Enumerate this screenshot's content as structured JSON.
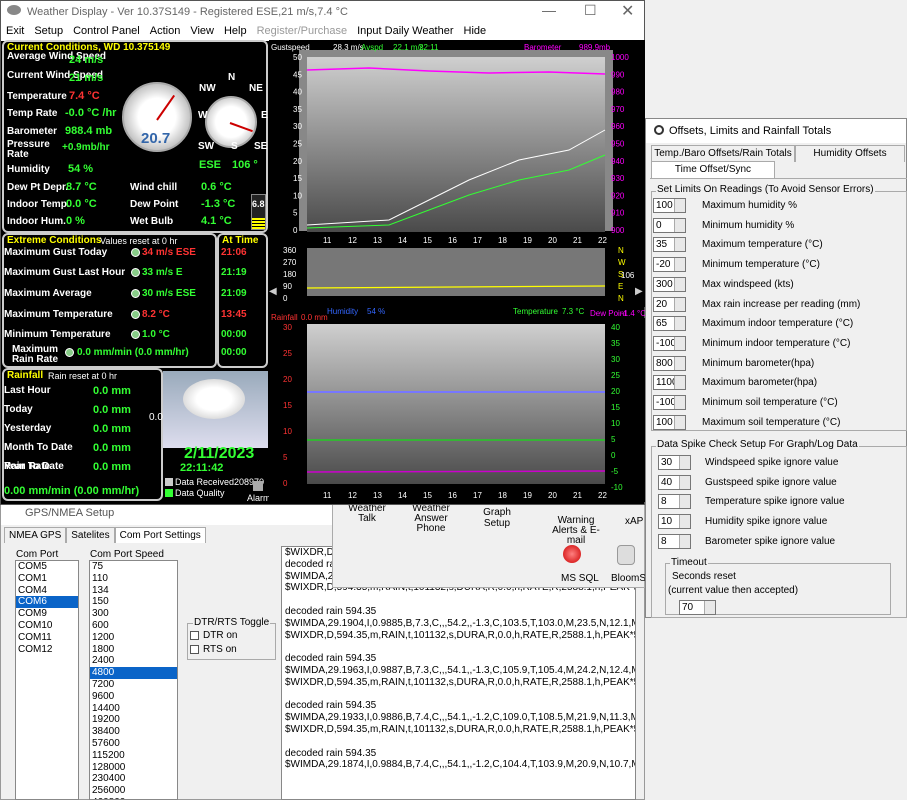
{
  "main_window": {
    "title": "Weather Display - Ver 10.37S149 - Registered ESE,21 m/s,7.4 °C",
    "menu": [
      "Exit",
      "Setup",
      "Control Panel",
      "Action",
      "View",
      "Help",
      "Register/Purchase",
      "Input Daily Weather",
      "Hide"
    ]
  },
  "current": {
    "header": "Current Conditions, WD 10.375149",
    "avg_wind_label": "Average Wind Speed",
    "avg_wind": "24 m/s",
    "cur_wind_label": "Current Wind Speed",
    "cur_wind": "21 m/s",
    "temp_label": "Temperature",
    "temp": "7.4 °C",
    "temp_rate_label": "Temp Rate",
    "temp_rate": "-0.0 °C /hr",
    "baro_label": "Barometer",
    "baro": "988.4 mb",
    "pressure_rate_label": "Pressure Rate",
    "pressure_rate": "+0.9mb/hr",
    "humidity_label": "Humidity",
    "humidity": "54 %",
    "dew_label": "Dew Pt Depr.",
    "dew": "8.7 °C",
    "indoor_temp_label": "Indoor Temp.",
    "indoor_temp": "0.0 °C",
    "indoor_hum_label": "Indoor Hum.",
    "indoor_hum": "0 %",
    "windchill_label": "Wind chill",
    "windchill": "0.6 °C",
    "dewpoint_label": "Dew Point",
    "dewpoint": "-1.3 °C",
    "wetbulb_label": "Wet Bulb",
    "wetbulb": "4.1 °C",
    "gauge_value": "20.7",
    "wind_dir": "ESE",
    "wind_deg": "106 °",
    "uv": "6.8",
    "compass": {
      "n": "N",
      "nw": "NW",
      "ne": "NE",
      "w": "W",
      "e": "E",
      "sw": "SW",
      "s": "S",
      "se": "SE"
    }
  },
  "extremes": {
    "header": "Extreme Conditions",
    "note": "Values reset at 0 hr",
    "at_time": "At Time",
    "rows": [
      {
        "label": "Maximum Gust Today",
        "value": "34 m/s ESE",
        "time": "21:06"
      },
      {
        "label": "Maximum Gust Last Hour",
        "value": "33 m/s  E",
        "time": "21:19"
      },
      {
        "label": "Maximum Average",
        "value": "30 m/s ESE",
        "time": "21:09"
      },
      {
        "label": "Maximum Temperature",
        "value": "8.2 °C",
        "time": "13:45"
      },
      {
        "label": "Minimum Temperature",
        "value": "1.0 °C",
        "time": "00:00"
      },
      {
        "label": "Maximum Rain Rate",
        "value": "0.0 mm/min (0.0 mm/hr)",
        "time": "00:00"
      }
    ]
  },
  "rain": {
    "header": "Rainfall",
    "note": "Rain reset at 0 hr",
    "rows": [
      {
        "label": "Last Hour",
        "value": "0.0 mm"
      },
      {
        "label": "Today",
        "value": "0.0 mm"
      },
      {
        "label": "Yesterday",
        "value": "0.0 mm"
      },
      {
        "label": "Month To Date",
        "value": "0.0 mm"
      },
      {
        "label": "Year To Date",
        "value": "0.0 mm"
      }
    ],
    "rate_label": "Rain Rate",
    "rate": "0.00 mm/min (0.00 mm/hr)"
  },
  "status": {
    "date": "2/11/2023",
    "time": "22:11:42",
    "icon_value": "0.0",
    "data_received": "Data Received208970",
    "data_quality": "Data Quality",
    "alarm": "Alarm"
  },
  "graph1": {
    "gust_label": "Gustspeed",
    "gust_val": "28.3 m/s",
    "avg_label": "Avspd",
    "avg_val": "22.1 m/s",
    "time_val": "22:11",
    "baro_label": "Barometer",
    "baro_val": "989.9mb",
    "yleft": [
      "50",
      "45",
      "40",
      "35",
      "30",
      "25",
      "20",
      "15",
      "10",
      "5",
      "0"
    ],
    "yright": [
      "1000",
      "990",
      "980",
      "970",
      "960",
      "950",
      "940",
      "930",
      "920",
      "910",
      "900"
    ],
    "x": [
      "11",
      "12",
      "13",
      "14",
      "15",
      "16",
      "17",
      "18",
      "19",
      "20",
      "21",
      "22"
    ]
  },
  "graph2": {
    "yleft": [
      "360",
      "270",
      "180",
      "90",
      "0"
    ],
    "dirs": [
      "N",
      "W",
      "S",
      "E",
      "N"
    ],
    "wdval": "106",
    "hum_label": "Humidity",
    "hum_val": "54 %",
    "temp_label": "Temperature",
    "temp_val": "7.3 °C",
    "dew_label": "Dew Point",
    "dew_val": "-1.4 °C"
  },
  "graph3": {
    "rain_label": "Rainfall",
    "rain_val": "0.0 mm",
    "yleft": [
      "30",
      "25",
      "20",
      "15",
      "10",
      "5",
      "0"
    ],
    "yright": [
      "40",
      "35",
      "30",
      "25",
      "20",
      "15",
      "10",
      "5",
      "0",
      "-5",
      "-10"
    ],
    "x": [
      "11",
      "12",
      "13",
      "14",
      "15",
      "16",
      "17",
      "18",
      "19",
      "20",
      "21",
      "22"
    ]
  },
  "gps": {
    "title": "GPS/NMEA Setup",
    "tabs": [
      "NMEA GPS",
      "Satelites",
      "Com Port Settings"
    ],
    "com_port_label": "Com Port",
    "com_ports": [
      "COM5",
      "COM1",
      "COM4",
      "COM6",
      "COM9",
      "COM10",
      "COM11",
      "COM12"
    ],
    "speed_label": "Com Port Speed",
    "speeds": [
      "75",
      "110",
      "134",
      "150",
      "300",
      "600",
      "1200",
      "1800",
      "2400",
      "4800",
      "7200",
      "9600",
      "14400",
      "19200",
      "38400",
      "57600",
      "115200",
      "128000",
      "230400",
      "256000",
      "460800",
      "921600"
    ],
    "dtr_group": "DTR/RTS Toggle",
    "dtr": "DTR on",
    "rts": "RTS on",
    "log": [
      "$WIXDR,D,",
      "decoded rai",
      "$WIMDA,29.1904,I,0.9885,B,7.4,C,,,54.2,,-1.2,C,111.3,T,110.8,M,22.7,N,11.7,M*46",
      "$WIXDR,D,594.35,m,RAIN,t,101132,s,DURA,R,0.0,h,RATE,R,2588.1,h,PEAK*53",
      "",
      "decoded rain 594.35",
      "$WIMDA,29.1904,I,0.9885,B,7.3,C,,,54.2,,-1.3,C,103.5,T,103.0,M,23.5,N,12.1,M*49",
      "$WIXDR,D,594.35,m,RAIN,t,101132,s,DURA,R,0.0,h,RATE,R,2588.1,h,PEAK*53",
      "",
      "decoded rain 594.35",
      "$WIMDA,29.1963,I,0.9887,B,7.3,C,,,54.1,,-1.3,C,105.9,T,105.4,M,24.2,N,12.4,M*44",
      "$WIXDR,D,594.35,m,RAIN,t,101132,s,DURA,R,0.0,h,RATE,R,2588.1,h,PEAK*53",
      "",
      "decoded rain 594.35",
      "$WIMDA,29.1933,I,0.9886,B,7.4,C,,,54.1,,-1.2,C,109.0,T,108.5,M,21.9,N,11.3,M*45",
      "$WIXDR,D,594.35,m,RAIN,t,101132,s,DURA,R,0.0,h,RATE,R,2588.1,h,PEAK*53",
      "",
      "decoded rain 594.35",
      "$WIMDA,29.1874,I,0.9884,B,7.4,C,,,54.1,,-1.2,C,104.4,T,103.9,M,20.9,N,10.7,M*45"
    ]
  },
  "control_panel": {
    "items": [
      "Weather Talk",
      "Weather Answer Phone",
      "Graph Setup",
      "Warning Alerts & E-mail",
      "xAP",
      "MS SQL",
      "BloomSk"
    ]
  },
  "offsets": {
    "title": "Offsets, Limits and Rainfall Totals",
    "tabs": [
      "Temp./Baro Offsets/Rain Totals",
      "Humidity Offsets",
      "Time Offset/Sync"
    ],
    "limits_group": "Set Limits On Readings (To Avoid Sensor Errors)",
    "limits": [
      {
        "value": "100",
        "label": "Maximum humidity %"
      },
      {
        "value": "0",
        "label": "Minimum humidity %"
      },
      {
        "value": "35",
        "label": "Maximum temperature (°C)"
      },
      {
        "value": "-20",
        "label": "Minimum temperature (°C)"
      },
      {
        "value": "300",
        "label": "Max windspeed (kts)"
      },
      {
        "value": "20",
        "label": "Max rain  increase per reading (mm)"
      },
      {
        "value": "65",
        "label": "Maximum indoor temperature (°C)"
      },
      {
        "value": "-100",
        "label": "Minimum indoor temperature (°C)"
      },
      {
        "value": "800",
        "label": "Minimum barometer(hpa)"
      },
      {
        "value": "1100",
        "label": "Maximum barometer(hpa)"
      },
      {
        "value": "-100",
        "label": "Minimum soil temperature (°C)"
      },
      {
        "value": "100",
        "label": "Maximum soil temperature (°C)"
      }
    ],
    "spike_group": "Data Spike Check Setup For Graph/Log Data",
    "spikes": [
      {
        "value": "30",
        "label": "Windspeed spike ignore value"
      },
      {
        "value": "40",
        "label": "Gustspeed spike ignore value"
      },
      {
        "value": "8",
        "label": "Temperature spike ignore value"
      },
      {
        "value": "10",
        "label": "Humidity spike ignore value"
      },
      {
        "value": "8",
        "label": "Barometer spike ignore value"
      }
    ],
    "timeout_group": "Timeout",
    "timeout_label": "Seconds reset",
    "timeout_note": "(current value then accepted)",
    "timeout_value": "70"
  }
}
